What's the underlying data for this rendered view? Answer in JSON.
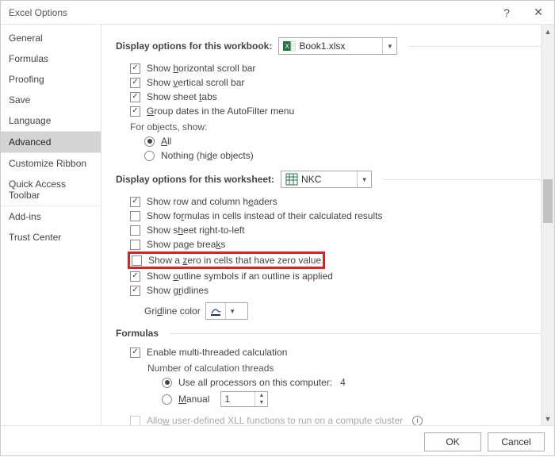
{
  "window": {
    "title": "Excel Options",
    "help_icon": "?",
    "close_icon": "✕"
  },
  "sidebar": {
    "items": [
      {
        "label": "General"
      },
      {
        "label": "Formulas"
      },
      {
        "label": "Proofing"
      },
      {
        "label": "Save"
      },
      {
        "label": "Language"
      },
      {
        "label": "Advanced",
        "selected": true
      },
      {
        "label": "Customize Ribbon"
      },
      {
        "label": "Quick Access Toolbar"
      },
      {
        "label": "Add-ins"
      },
      {
        "label": "Trust Center"
      }
    ]
  },
  "content": {
    "workbook_section": {
      "heading": "Display options for this workbook:",
      "combo_value": "Book1.xlsx",
      "options": [
        {
          "label": "Show horizontal scroll bar",
          "checked": true,
          "accel_after": "h"
        },
        {
          "label": "Show vertical scroll bar",
          "checked": true,
          "accel_after": "v"
        },
        {
          "label": "Show sheet tabs",
          "checked": true,
          "accel_after": "t"
        },
        {
          "label": "Group dates in the AutoFilter menu",
          "checked": true,
          "accel_after": "d"
        }
      ],
      "objects_label": "For objects, show:",
      "objects_radio": {
        "all": "All",
        "nothing": "Nothing (hide objects)",
        "selected": "all"
      }
    },
    "worksheet_section": {
      "heading": "Display options for this worksheet:",
      "combo_value": "NKC",
      "options": [
        {
          "label": "Show row and column headers",
          "checked": true
        },
        {
          "label": "Show formulas in cells instead of their calculated results",
          "checked": false
        },
        {
          "label": "Show sheet right-to-left",
          "checked": false
        },
        {
          "label": "Show page breaks",
          "checked": false
        },
        {
          "label": "Show a zero in cells that have zero value",
          "checked": false,
          "highlight": true
        },
        {
          "label": "Show outline symbols if an outline is applied",
          "checked": true
        },
        {
          "label": "Show gridlines",
          "checked": true
        }
      ],
      "gridline_color_label": "Gridline color"
    },
    "formulas_section": {
      "heading": "Formulas",
      "multithread_label": "Enable multi-threaded calculation",
      "multithread_checked": true,
      "threads_label": "Number of calculation threads",
      "use_all_label": "Use all processors on this computer:",
      "use_all_count": "4",
      "manual_label": "Manual",
      "manual_value": "1",
      "threads_selected": "all",
      "xll_label": "Allow user-defined XLL functions to run on a compute cluster",
      "xll_checked": false,
      "xll_disabled": true
    }
  },
  "buttons": {
    "ok": "OK",
    "cancel": "Cancel"
  }
}
